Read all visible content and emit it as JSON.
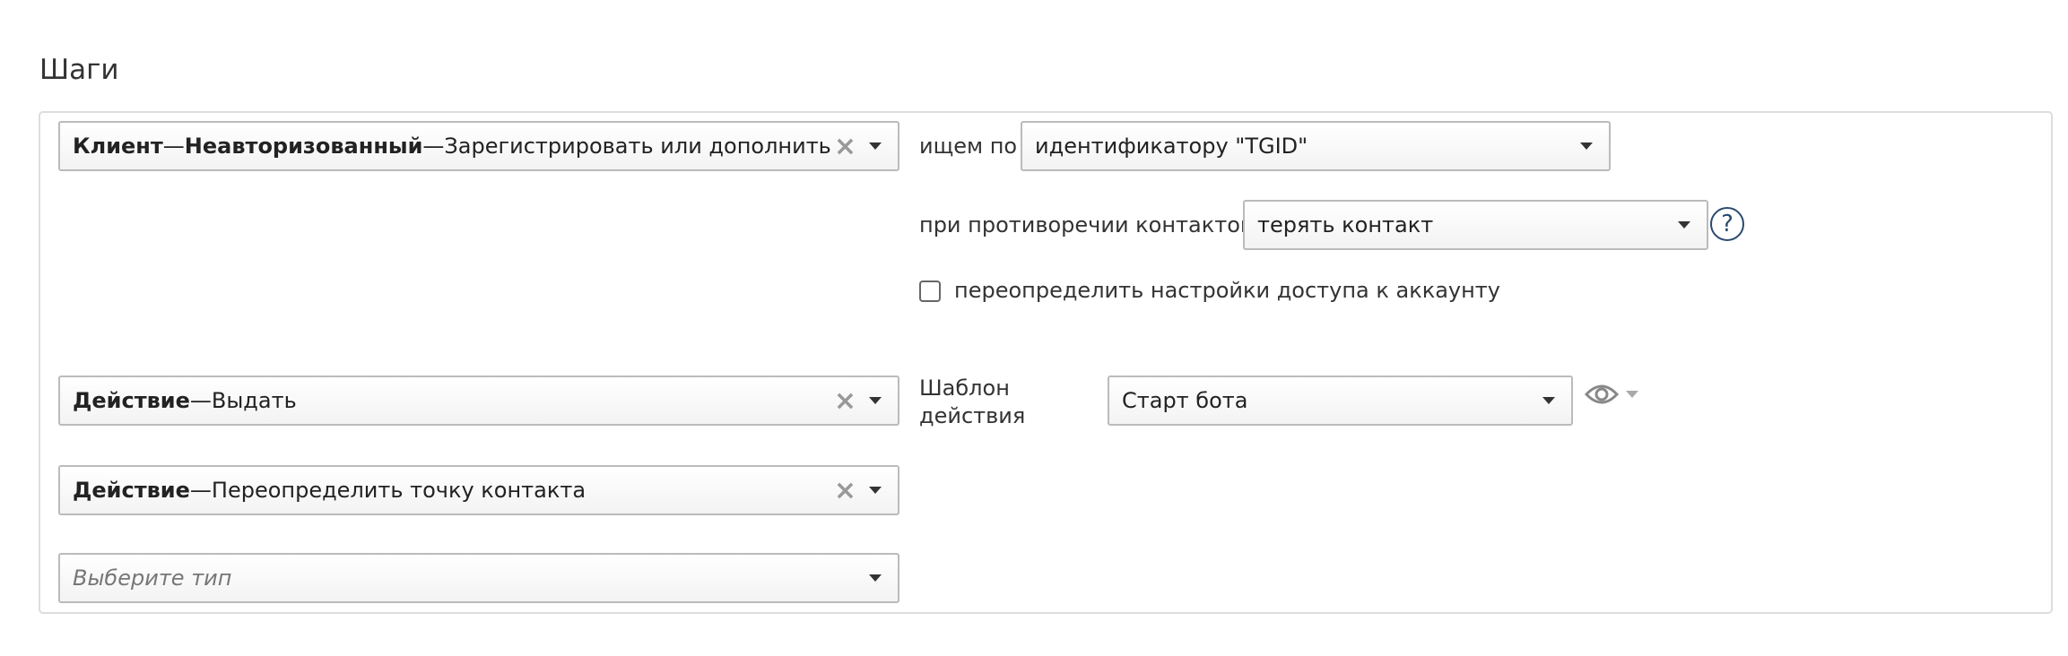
{
  "section_title": "Шаги",
  "steps": [
    {
      "type_bold": "Клиент",
      "sep": " — ",
      "subtype_bold": "Неавторизованный",
      "sep2": " — ",
      "action": "Зарегистрировать или дополнить"
    },
    {
      "type_bold": "Действие",
      "sep": " — ",
      "action": "Выдать"
    },
    {
      "type_bold": "Действие",
      "sep": " — ",
      "action": "Переопределить точку контакта"
    }
  ],
  "new_step_placeholder": "Выберите тип",
  "search_by": {
    "label": "ищем по",
    "value": "идентификатору \"TGID\""
  },
  "conflict": {
    "label": "при противоречии контактов",
    "value": "терять контакт",
    "help": "?"
  },
  "override_access": {
    "label": "переопределить настройки доступа к аккаунту",
    "checked": false
  },
  "template": {
    "label_line1": "Шаблон",
    "label_line2": "действия",
    "value": "Старт бота"
  },
  "icons": {
    "clear": "×",
    "eye": "eye-icon",
    "caret": "caret-down-icon"
  },
  "colors": {
    "help": "#2b4a6f",
    "border": "#bbbbbb"
  }
}
